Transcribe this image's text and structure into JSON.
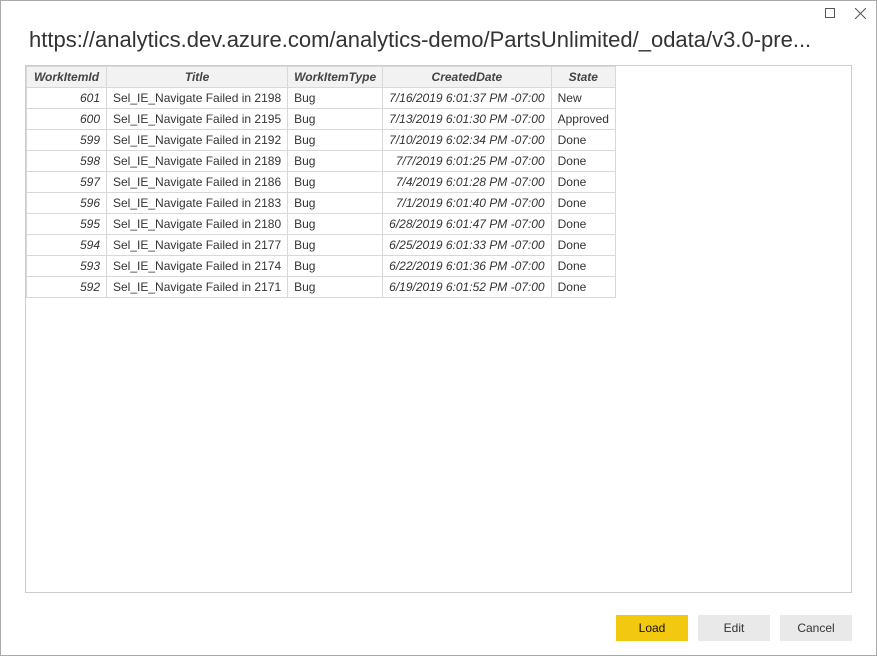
{
  "window": {
    "url_text": "https://analytics.dev.azure.com/analytics-demo/PartsUnlimited/_odata/v3.0-pre..."
  },
  "table": {
    "columns": {
      "workItemId": "WorkItemId",
      "title": "Title",
      "workItemType": "WorkItemType",
      "createdDate": "CreatedDate",
      "state": "State"
    },
    "rows": [
      {
        "id": "601",
        "title": "Sel_IE_Navigate Failed in 2198",
        "type": "Bug",
        "date": "7/16/2019 6:01:37 PM -07:00",
        "state": "New"
      },
      {
        "id": "600",
        "title": "Sel_IE_Navigate Failed in 2195",
        "type": "Bug",
        "date": "7/13/2019 6:01:30 PM -07:00",
        "state": "Approved"
      },
      {
        "id": "599",
        "title": "Sel_IE_Navigate Failed in 2192",
        "type": "Bug",
        "date": "7/10/2019 6:02:34 PM -07:00",
        "state": "Done"
      },
      {
        "id": "598",
        "title": "Sel_IE_Navigate Failed in 2189",
        "type": "Bug",
        "date": "7/7/2019 6:01:25 PM -07:00",
        "state": "Done"
      },
      {
        "id": "597",
        "title": "Sel_IE_Navigate Failed in 2186",
        "type": "Bug",
        "date": "7/4/2019 6:01:28 PM -07:00",
        "state": "Done"
      },
      {
        "id": "596",
        "title": "Sel_IE_Navigate Failed in 2183",
        "type": "Bug",
        "date": "7/1/2019 6:01:40 PM -07:00",
        "state": "Done"
      },
      {
        "id": "595",
        "title": "Sel_IE_Navigate Failed in 2180",
        "type": "Bug",
        "date": "6/28/2019 6:01:47 PM -07:00",
        "state": "Done"
      },
      {
        "id": "594",
        "title": "Sel_IE_Navigate Failed in 2177",
        "type": "Bug",
        "date": "6/25/2019 6:01:33 PM -07:00",
        "state": "Done"
      },
      {
        "id": "593",
        "title": "Sel_IE_Navigate Failed in 2174",
        "type": "Bug",
        "date": "6/22/2019 6:01:36 PM -07:00",
        "state": "Done"
      },
      {
        "id": "592",
        "title": "Sel_IE_Navigate Failed in 2171",
        "type": "Bug",
        "date": "6/19/2019 6:01:52 PM -07:00",
        "state": "Done"
      }
    ]
  },
  "buttons": {
    "load": "Load",
    "edit": "Edit",
    "cancel": "Cancel"
  }
}
